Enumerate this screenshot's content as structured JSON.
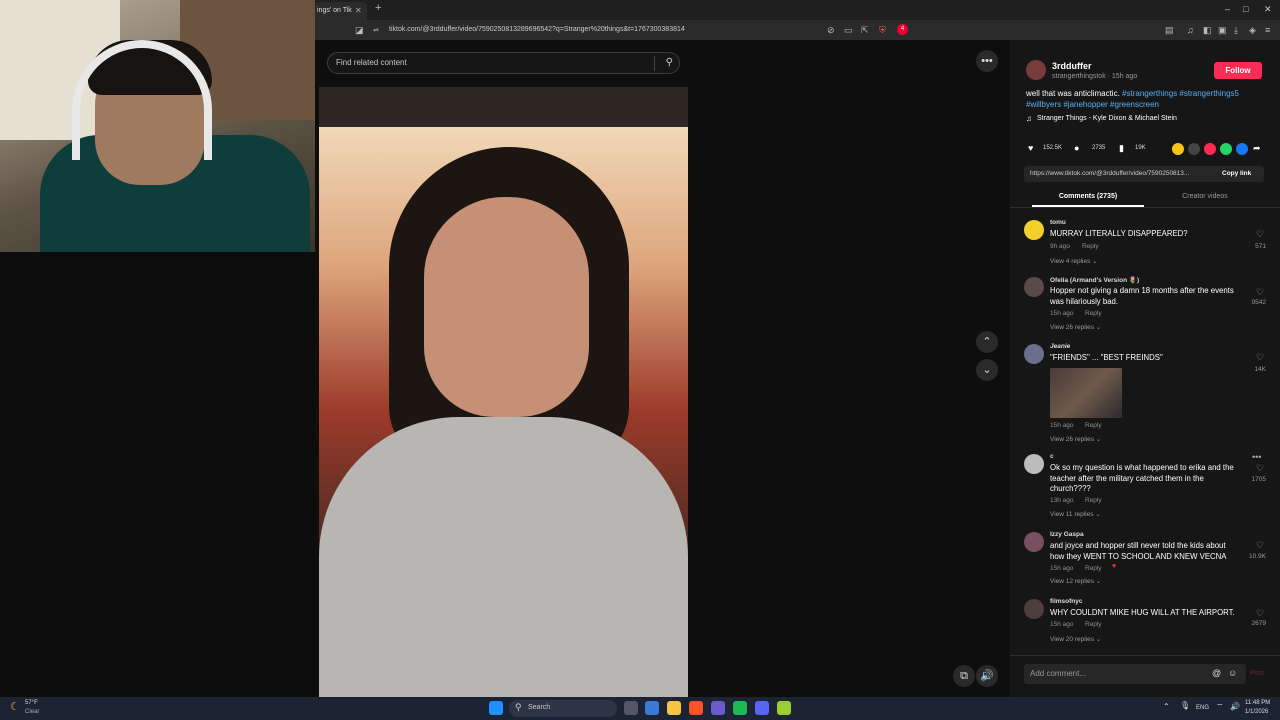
{
  "browser": {
    "tab_title": "ings' on Tik",
    "url": "tiktok.com/@3rdduffer/video/7590250813289696542?q=Stranger%20things&t=1767300383814",
    "new_tab": "+",
    "badge_count": "4"
  },
  "search": {
    "placeholder": "Find related content"
  },
  "post": {
    "username": "3rdduffer",
    "handle_time": "strangerthingstok · 15h ago",
    "follow_label": "Follow",
    "caption": "well that was anticlimactic.",
    "hashtags_line1": "#strangerthings #strangerthings5",
    "hashtags_line2": "#willbyers #janehopper #greenscreen",
    "music": "Stranger Things - Kyle Dixon & Michael Stein",
    "likes": "152.5K",
    "comments": "2735",
    "saves": "19K",
    "link": "https://www.tiktok.com/@3rdduffer/video/7590250813...",
    "copy_link_label": "Copy link"
  },
  "tabs": {
    "comments": "Comments (2735)",
    "creator": "Creator videos"
  },
  "comments": [
    {
      "name": "tomu",
      "text": "MURRAY LITERALLY DISAPPEARED?",
      "time": "9h ago",
      "reply": "Reply",
      "replies": "View 4 replies ⌄",
      "likes": "571"
    },
    {
      "name": "Ofelia (Armand's Version 🌷)",
      "text": "Hopper not giving a damn 18 months after the events was hilariously bad.",
      "time": "15h ago",
      "reply": "Reply",
      "replies": "View 26 replies ⌄",
      "likes": "9542"
    },
    {
      "name": "Jeanie",
      "text": "\"FRIENDS\" ... \"BEST FREINDS\"",
      "time": "15h ago",
      "reply": "Reply",
      "replies": "View 26 replies ⌄",
      "likes": "14K"
    },
    {
      "name": "c",
      "text": "Ok so my question is what happened to erika and the teacher after the military catched them in the church????",
      "time": "13h ago",
      "reply": "Reply",
      "replies": "View 11 replies ⌄",
      "likes": "1705"
    },
    {
      "name": "Izzy Gaspa",
      "text": "and joyce and hopper still never told the kids about how they WENT TO SCHOOL AND KNEW VECNA",
      "time": "15h ago",
      "reply": "Reply",
      "replies": "View 12 replies ⌄",
      "likes": "10.9K"
    },
    {
      "name": "filmsofnyc",
      "text": "WHY COULDNT MIKE HUG WILL AT THE AIRPORT.",
      "time": "15h ago",
      "reply": "Reply",
      "replies": "View 20 replies ⌄",
      "likes": "2679"
    }
  ],
  "add_comment": {
    "placeholder": "Add comment...",
    "post_label": "Post"
  },
  "taskbar": {
    "weather_temp": "57°F",
    "weather_desc": "Clear",
    "search_label": "Search",
    "lang": "ENG",
    "time": "11:48 PM",
    "date": "1/1/2026"
  },
  "icons": [
    "more-icon",
    "chevron-up-icon",
    "chevron-down-icon",
    "volume-icon",
    "pip-icon",
    "heart-icon",
    "comment-icon",
    "bookmark-icon",
    "music-note-icon",
    "search-icon"
  ],
  "colors": {
    "accent": "#fe2c55",
    "hashtag": "#5ab0f5"
  }
}
